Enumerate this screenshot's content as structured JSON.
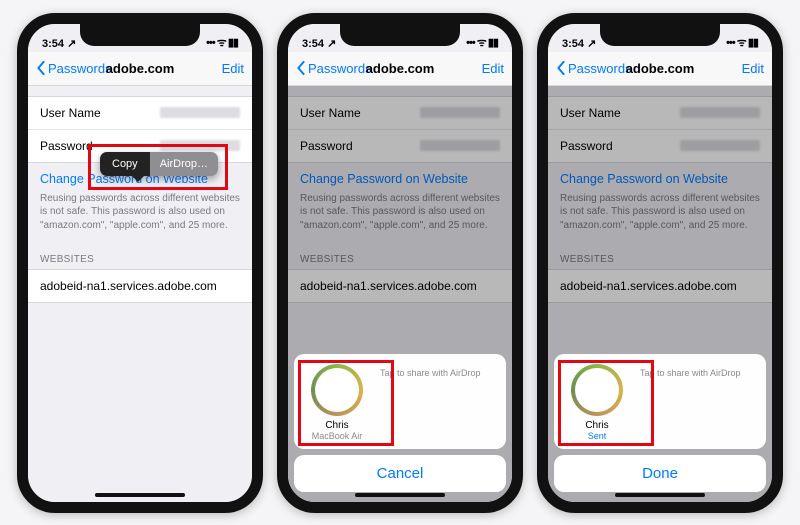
{
  "status": {
    "time": "3:54",
    "carrier_icon": "↗",
    "right": "••• ᯤ ▮▮"
  },
  "nav": {
    "back": "Passwords",
    "title": "adobe.com",
    "edit": "Edit"
  },
  "rows": {
    "username_label": "User Name",
    "password_label": "Password"
  },
  "change_link": "Change Password on Website",
  "note": "Reusing passwords across different websites is not safe. This password is also used on \"amazon.com\", \"apple.com\", and 25 more.",
  "websites_header": "WEBSITES",
  "website": "adobeid-na1.services.adobe.com",
  "bubble": {
    "copy": "Copy",
    "airdrop": "AirDrop…"
  },
  "airdrop": {
    "hint": "Tap to share with AirDrop",
    "contact_name": "Chris",
    "contact_sub": "MacBook Air",
    "contact_sent": "Sent",
    "cancel": "Cancel",
    "done": "Done"
  }
}
